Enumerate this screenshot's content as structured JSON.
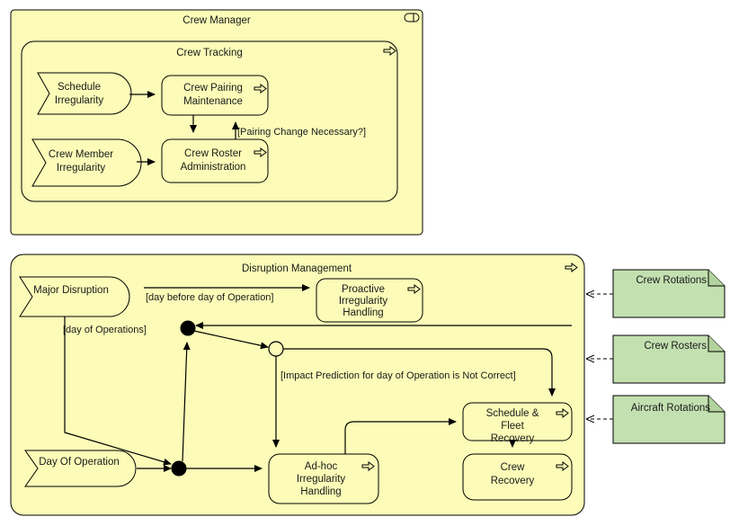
{
  "palette": {
    "process_fill": "#fcfcb8",
    "process_stroke": "#000000",
    "artifact_fill": "#c3e0b0",
    "artifact_stroke": "#000000",
    "line": "#000000",
    "text": "#1a1a1a",
    "background": "#ffffff"
  },
  "containers": [
    {
      "id": "crew-manager",
      "title": "Crew Manager",
      "icon": "component-icon"
    },
    {
      "id": "crew-tracking",
      "title": "Crew Tracking",
      "icon": "process-arrow-icon"
    },
    {
      "id": "disruption-management",
      "title": "Disruption Management",
      "icon": "process-arrow-icon"
    }
  ],
  "events": [
    {
      "id": "schedule-irregularity",
      "label_lines": [
        "Schedule",
        "Irregularity"
      ]
    },
    {
      "id": "crew-member-irregularity",
      "label_lines": [
        "Crew Member",
        "Irregularity"
      ]
    },
    {
      "id": "major-disruption",
      "label_lines": [
        "Major Disruption"
      ]
    },
    {
      "id": "day-of-operation",
      "label_lines": [
        "Day Of Operation"
      ]
    }
  ],
  "activities": [
    {
      "id": "crew-pairing-maintenance",
      "label_lines": [
        "Crew Pairing",
        "Maintenance"
      ],
      "icon": "process-arrow-icon"
    },
    {
      "id": "crew-roster-administration",
      "label_lines": [
        "Crew Roster",
        "Administration"
      ],
      "icon": "process-arrow-icon"
    },
    {
      "id": "proactive-irregularity-handling",
      "label_lines": [
        "Proactive",
        "Irregularity",
        "Handling"
      ],
      "icon": "process-arrow-icon"
    },
    {
      "id": "ad-hoc-irregularity-handling",
      "label_lines": [
        "Ad-hoc",
        "Irregularity",
        "Handling"
      ],
      "icon": "process-arrow-icon"
    },
    {
      "id": "schedule-fleet-recovery",
      "label_lines": [
        "Schedule &",
        "Fleet",
        "Recovery"
      ],
      "icon": "process-arrow-icon"
    },
    {
      "id": "crew-recovery",
      "label_lines": [
        "Crew",
        "Recovery"
      ],
      "icon": "process-arrow-icon"
    }
  ],
  "guards": [
    {
      "id": "pairing-change-necessary",
      "text": "[Pairing Change Necessary?]"
    },
    {
      "id": "day-before-day-of-operation",
      "text": "[day before day of Operation]"
    },
    {
      "id": "day-of-operations",
      "text": "[day of Operations]"
    },
    {
      "id": "impact-prediction-not-correct",
      "text": "[Impact Prediction for day of Operation is Not Correct]"
    }
  ],
  "artifacts": [
    {
      "id": "crew-rotations",
      "label": "Crew Rotations"
    },
    {
      "id": "crew-rosters",
      "label": "Crew Rosters"
    },
    {
      "id": "aircraft-rotations",
      "label": "Aircraft Rotations"
    }
  ],
  "nodes": [
    {
      "id": "merge-node-upper",
      "type": "merge",
      "style": "filled"
    },
    {
      "id": "decision-node",
      "type": "decision",
      "style": "hollow"
    },
    {
      "id": "merge-node-lower",
      "type": "merge",
      "style": "filled"
    }
  ]
}
